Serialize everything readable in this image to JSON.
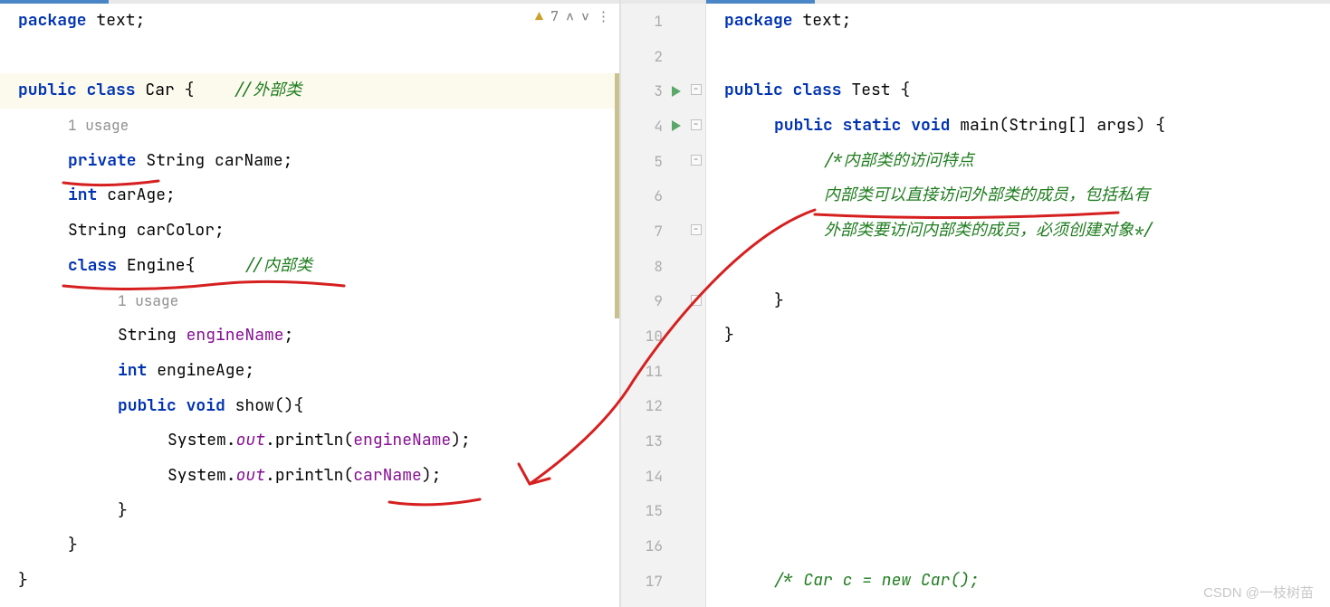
{
  "left": {
    "inspection": {
      "warn_count": "7",
      "nav_up": "∧",
      "nav_down": "∨",
      "more": "⋮"
    },
    "lines": [
      {
        "tokens": [
          {
            "t": "package ",
            "c": "kw"
          },
          {
            "t": "text;",
            "c": ""
          }
        ]
      },
      {
        "tokens": []
      },
      {
        "hl": true,
        "diff": true,
        "tokens": [
          {
            "t": "public class ",
            "c": "kw"
          },
          {
            "t": "Car ",
            "c": "cls"
          },
          {
            "t": "{    ",
            "c": ""
          },
          {
            "t": "//外部类",
            "c": "com-green"
          }
        ]
      },
      {
        "diff": true,
        "indent": 1,
        "tokens": [
          {
            "t": "1 usage",
            "c": "usage"
          }
        ]
      },
      {
        "diff": true,
        "indent": 1,
        "tokens": [
          {
            "t": "private ",
            "c": "kw"
          },
          {
            "t": "String ",
            "c": ""
          },
          {
            "t": "carName;",
            "c": ""
          }
        ]
      },
      {
        "diff": true,
        "indent": 1,
        "tokens": [
          {
            "t": "int ",
            "c": "kw"
          },
          {
            "t": "carAge;",
            "c": ""
          }
        ]
      },
      {
        "diff": true,
        "indent": 1,
        "tokens": [
          {
            "t": "String ",
            "c": ""
          },
          {
            "t": "carColor;",
            "c": ""
          }
        ]
      },
      {
        "diff": true,
        "indent": 1,
        "tokens": [
          {
            "t": "class ",
            "c": "kw"
          },
          {
            "t": "Engine",
            "c": "cls"
          },
          {
            "t": "{     ",
            "c": ""
          },
          {
            "t": "//内部类",
            "c": "com-green"
          }
        ]
      },
      {
        "diff": true,
        "indent": 2,
        "tokens": [
          {
            "t": "1 usage",
            "c": "usage"
          }
        ]
      },
      {
        "indent": 2,
        "tokens": [
          {
            "t": "String ",
            "c": ""
          },
          {
            "t": "engineName",
            "c": "fld"
          },
          {
            "t": ";",
            "c": ""
          }
        ]
      },
      {
        "indent": 2,
        "tokens": [
          {
            "t": "int ",
            "c": "kw"
          },
          {
            "t": "engineAge;",
            "c": ""
          }
        ]
      },
      {
        "indent": 2,
        "tokens": [
          {
            "t": "public void ",
            "c": "kw"
          },
          {
            "t": "show",
            "c": ""
          },
          {
            "t": "(){",
            "c": ""
          }
        ]
      },
      {
        "indent": 3,
        "tokens": [
          {
            "t": "System.",
            "c": ""
          },
          {
            "t": "out",
            "c": "fld-i"
          },
          {
            "t": ".println(",
            "c": ""
          },
          {
            "t": "engineName",
            "c": "fld"
          },
          {
            "t": ");",
            "c": ""
          }
        ]
      },
      {
        "indent": 3,
        "tokens": [
          {
            "t": "System.",
            "c": ""
          },
          {
            "t": "out",
            "c": "fld-i"
          },
          {
            "t": ".println(",
            "c": ""
          },
          {
            "t": "carName",
            "c": "fld"
          },
          {
            "t": ");",
            "c": ""
          }
        ]
      },
      {
        "indent": 2,
        "tokens": [
          {
            "t": "}",
            "c": ""
          }
        ]
      },
      {
        "indent": 1,
        "tokens": [
          {
            "t": "}",
            "c": ""
          }
        ]
      },
      {
        "tokens": [
          {
            "t": "}",
            "c": ""
          }
        ]
      }
    ]
  },
  "gutter": {
    "rows": [
      {
        "n": "1"
      },
      {
        "n": "2"
      },
      {
        "n": "3",
        "run": true,
        "fold": true
      },
      {
        "n": "4",
        "run": true,
        "fold": true
      },
      {
        "n": "5",
        "fold": true
      },
      {
        "n": "6"
      },
      {
        "n": "7",
        "fold": true
      },
      {
        "n": "8"
      },
      {
        "n": "9",
        "fold": true
      },
      {
        "n": "10"
      },
      {
        "n": "11"
      },
      {
        "n": "12"
      },
      {
        "n": "13"
      },
      {
        "n": "14"
      },
      {
        "n": "15"
      },
      {
        "n": "16"
      },
      {
        "n": "17"
      }
    ]
  },
  "right": {
    "lines": [
      {
        "tokens": [
          {
            "t": "package ",
            "c": "kw"
          },
          {
            "t": "text;",
            "c": ""
          }
        ]
      },
      {
        "tokens": []
      },
      {
        "tokens": [
          {
            "t": "public class ",
            "c": "kw"
          },
          {
            "t": "Test {",
            "c": ""
          }
        ]
      },
      {
        "indent": 1,
        "tokens": [
          {
            "t": "public static void ",
            "c": "kw"
          },
          {
            "t": "main",
            "c": ""
          },
          {
            "t": "(String[] args) {",
            "c": ""
          }
        ]
      },
      {
        "indent": 2,
        "tokens": [
          {
            "t": "/*内部类的访问特点",
            "c": "com-green"
          }
        ]
      },
      {
        "indent": 2,
        "tokens": [
          {
            "t": "内部类可以直接访问外部类的成员，包括私有",
            "c": "com-green"
          }
        ]
      },
      {
        "indent": 2,
        "tokens": [
          {
            "t": "外部类要访问内部类的成员，必须创建对象*/",
            "c": "com-green"
          }
        ]
      },
      {
        "tokens": []
      },
      {
        "indent": 1,
        "tokens": [
          {
            "t": "}",
            "c": ""
          }
        ]
      },
      {
        "tokens": [
          {
            "t": "}",
            "c": ""
          }
        ]
      },
      {
        "tokens": []
      },
      {
        "tokens": []
      },
      {
        "tokens": []
      },
      {
        "tokens": []
      },
      {
        "tokens": []
      },
      {
        "tokens": []
      },
      {
        "indent": 1,
        "tokens": [
          {
            "t": "/* Car c = new Car();",
            "c": "com-green"
          }
        ]
      }
    ]
  },
  "watermark": "CSDN @一枝树苗"
}
